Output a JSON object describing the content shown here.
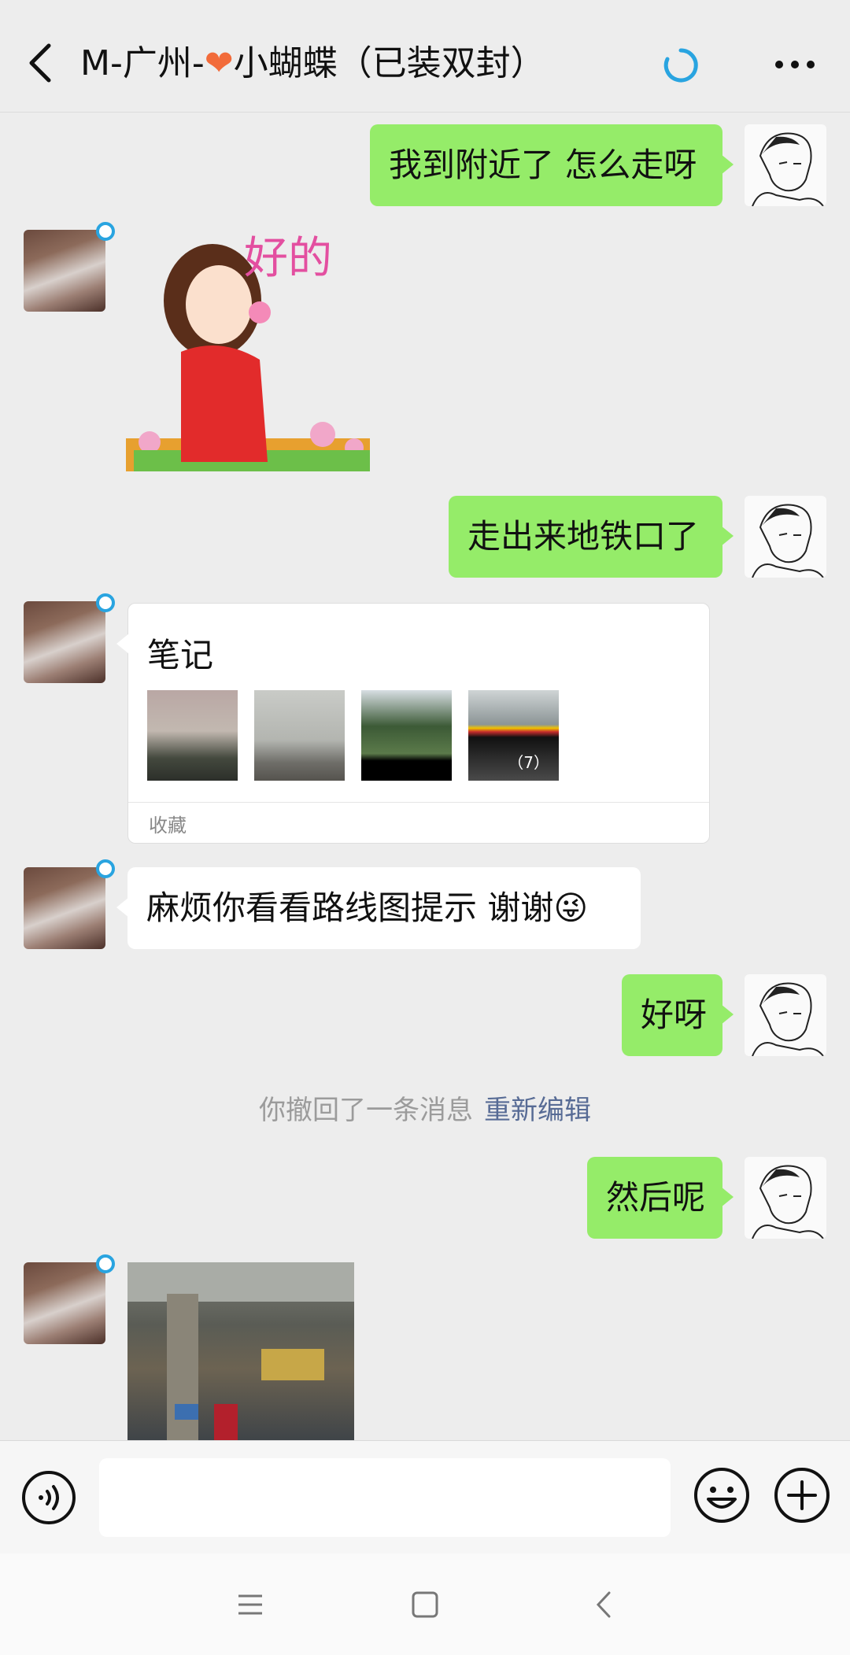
{
  "header": {
    "title_prefix": "M-广州-",
    "title_suffix": "小蝴蝶（已装双封）"
  },
  "messages": [
    {
      "side": "me",
      "text": "我到附近了 怎么走呀"
    },
    {
      "side": "her",
      "sticker_text": "好的"
    },
    {
      "side": "me",
      "text": "走出来地铁口了"
    },
    {
      "side": "her",
      "note": {
        "title": "笔记",
        "more_count": "（7）",
        "footer": "收藏"
      }
    },
    {
      "side": "her",
      "text": "麻烦你看看路线图提示 谢谢"
    },
    {
      "side": "me",
      "text": "好呀"
    },
    {
      "side": "me",
      "text": "然后呢"
    }
  ],
  "recall": {
    "text": "你撤回了一条消息",
    "edit_label": "重新编辑"
  },
  "colors": {
    "my_bubble": "#95ec69",
    "her_bubble": "#ffffff",
    "background": "#ededed",
    "link": "#576b95",
    "online_ring": "#29a4e0"
  },
  "icons": {
    "back": "chevron-left-icon",
    "status": "loading-ring-icon",
    "more": "more-dots-icon",
    "voice": "voice-icon",
    "emoji": "emoji-smile-icon",
    "plus": "plus-circle-icon"
  }
}
